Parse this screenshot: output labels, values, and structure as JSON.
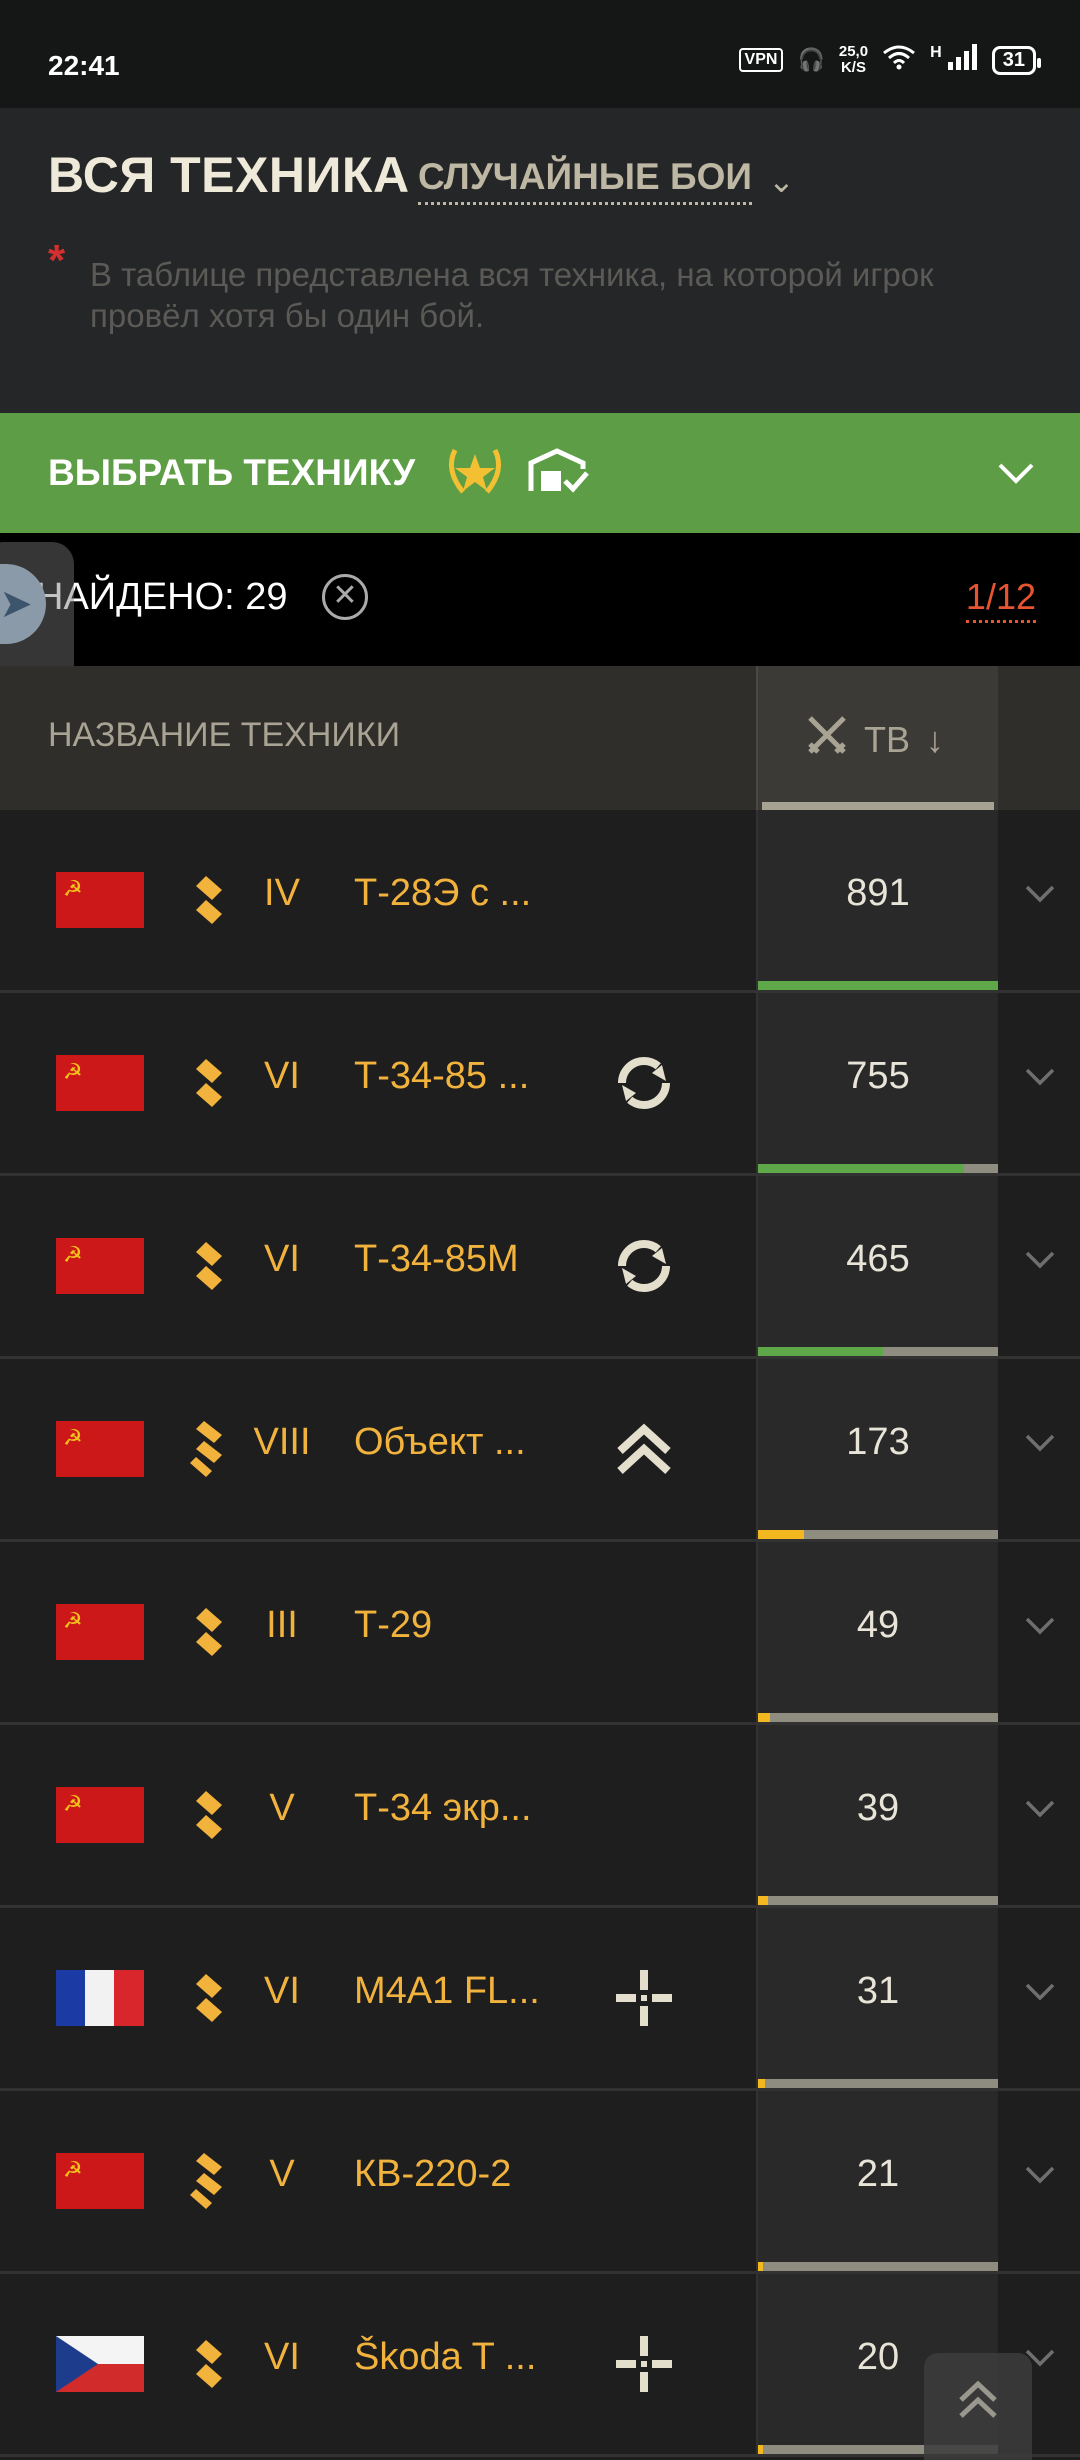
{
  "status_bar": {
    "time": "22:41",
    "vpn": "VPN",
    "speed_value": "25,0",
    "speed_unit": "K/S",
    "network": "H",
    "battery": "31"
  },
  "header": {
    "title": "ВСЯ ТЕХНИКА",
    "mode_label": "СЛУЧАЙНЫЕ БОИ",
    "note_marker": "*",
    "note": "В таблице представлена вся техника, на которой игрок провёл хотя бы один бой."
  },
  "select_bar": {
    "label": "ВЫБРАТЬ ТЕХНИКУ"
  },
  "found_bar": {
    "label": "НАЙДЕНО: 29",
    "page": "1/12"
  },
  "table_header": {
    "name_col": "НАЗВАНИЕ ТЕХНИКИ",
    "sort_col": "ТВ"
  },
  "colors": {
    "accent_green": "#5c9d45",
    "gold": "#f2b33d",
    "page_red": "#e75530"
  },
  "rows": [
    {
      "flag": "ussr",
      "class_icon": "medium-tank-icon",
      "tier": "IV",
      "name": "Т-28Э с ...",
      "tag": "",
      "battles": "891",
      "fill": 1.0,
      "fill_color": "#5fa84a"
    },
    {
      "flag": "ussr",
      "class_icon": "medium-tank-icon",
      "tier": "VI",
      "name": "Т-34-85 ...",
      "tag": "rotation-icon",
      "battles": "755",
      "fill": 0.86,
      "fill_color": "#5fa84a"
    },
    {
      "flag": "ussr",
      "class_icon": "medium-tank-icon",
      "tier": "VI",
      "name": "Т-34-85М",
      "tag": "rotation-icon",
      "battles": "465",
      "fill": 0.52,
      "fill_color": "#5fa84a"
    },
    {
      "flag": "ussr",
      "class_icon": "heavy-tank-icon",
      "tier": "VIII",
      "name": "Объект ...",
      "tag": "rank-up-icon",
      "battles": "173",
      "fill": 0.19,
      "fill_color": "#f3b71f"
    },
    {
      "flag": "ussr",
      "class_icon": "medium-tank-icon",
      "tier": "III",
      "name": "Т-29",
      "tag": "",
      "battles": "49",
      "fill": 0.05,
      "fill_color": "#f3b71f"
    },
    {
      "flag": "ussr",
      "class_icon": "medium-tank-icon",
      "tier": "V",
      "name": "Т-34 экр...",
      "tag": "",
      "battles": "39",
      "fill": 0.04,
      "fill_color": "#f3b71f"
    },
    {
      "flag": "france",
      "class_icon": "medium-tank-icon",
      "tier": "VI",
      "name": "M4A1 FL...",
      "tag": "crosshair-icon",
      "battles": "31",
      "fill": 0.03,
      "fill_color": "#f3b71f"
    },
    {
      "flag": "ussr",
      "class_icon": "heavy-tank-icon",
      "tier": "V",
      "name": "КВ-220-2",
      "tag": "",
      "battles": "21",
      "fill": 0.02,
      "fill_color": "#f3b71f"
    },
    {
      "flag": "czech",
      "class_icon": "medium-tank-icon",
      "tier": "VI",
      "name": "Škoda T ...",
      "tag": "crosshair-icon",
      "battles": "20",
      "fill": 0.02,
      "fill_color": "#f3b71f"
    }
  ]
}
